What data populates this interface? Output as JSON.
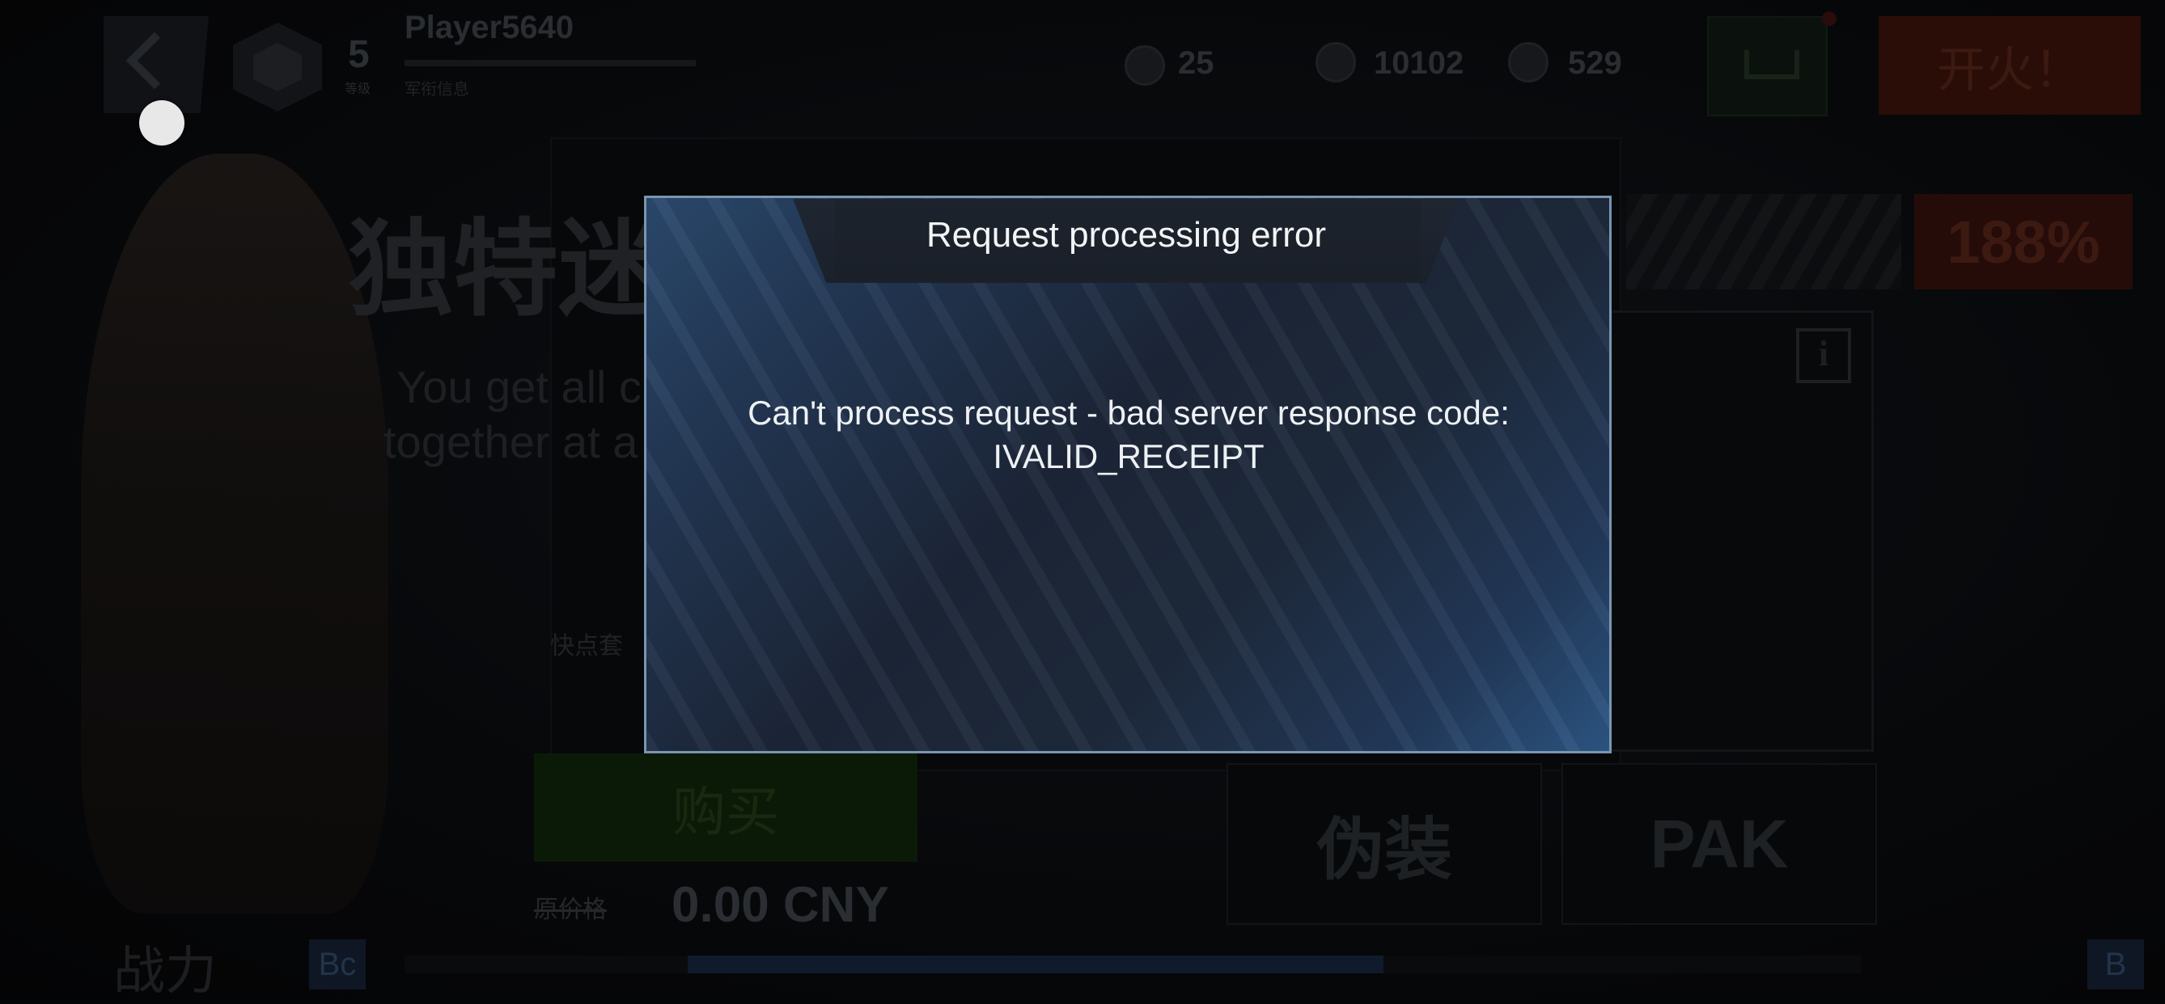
{
  "header": {
    "player_level": "5",
    "level_caption": "等级",
    "player_name": "Player5640",
    "player_sub": "军衔信息",
    "resources": [
      {
        "icon": "bullet-icon",
        "value": "25"
      },
      {
        "icon": "coin-icon",
        "value": "10102"
      },
      {
        "icon": "gold-icon",
        "value": "529"
      }
    ],
    "fire_label": "开火！"
  },
  "shop": {
    "title": "独特迷",
    "desc_line1": "You get all c",
    "desc_line2": "together at a",
    "quick_text": "快点套",
    "buy_label": "购买",
    "old_price": "原价格",
    "price": "0.00 CNY",
    "discount": "188%",
    "tab_camo": "伪装",
    "tab_pak": "PAK",
    "power_label": "战力",
    "power_badge": "Bc",
    "end_badge": "B"
  },
  "dialog": {
    "title": "Request processing error",
    "message_line1": "Can't process request - bad server response code:",
    "message_line2": "IVALID_RECEIPT"
  },
  "colors": {
    "dialog_border": "#7a95b0",
    "dialog_bg_dark": "#1c2638",
    "dialog_bg_light": "#2d5785"
  }
}
